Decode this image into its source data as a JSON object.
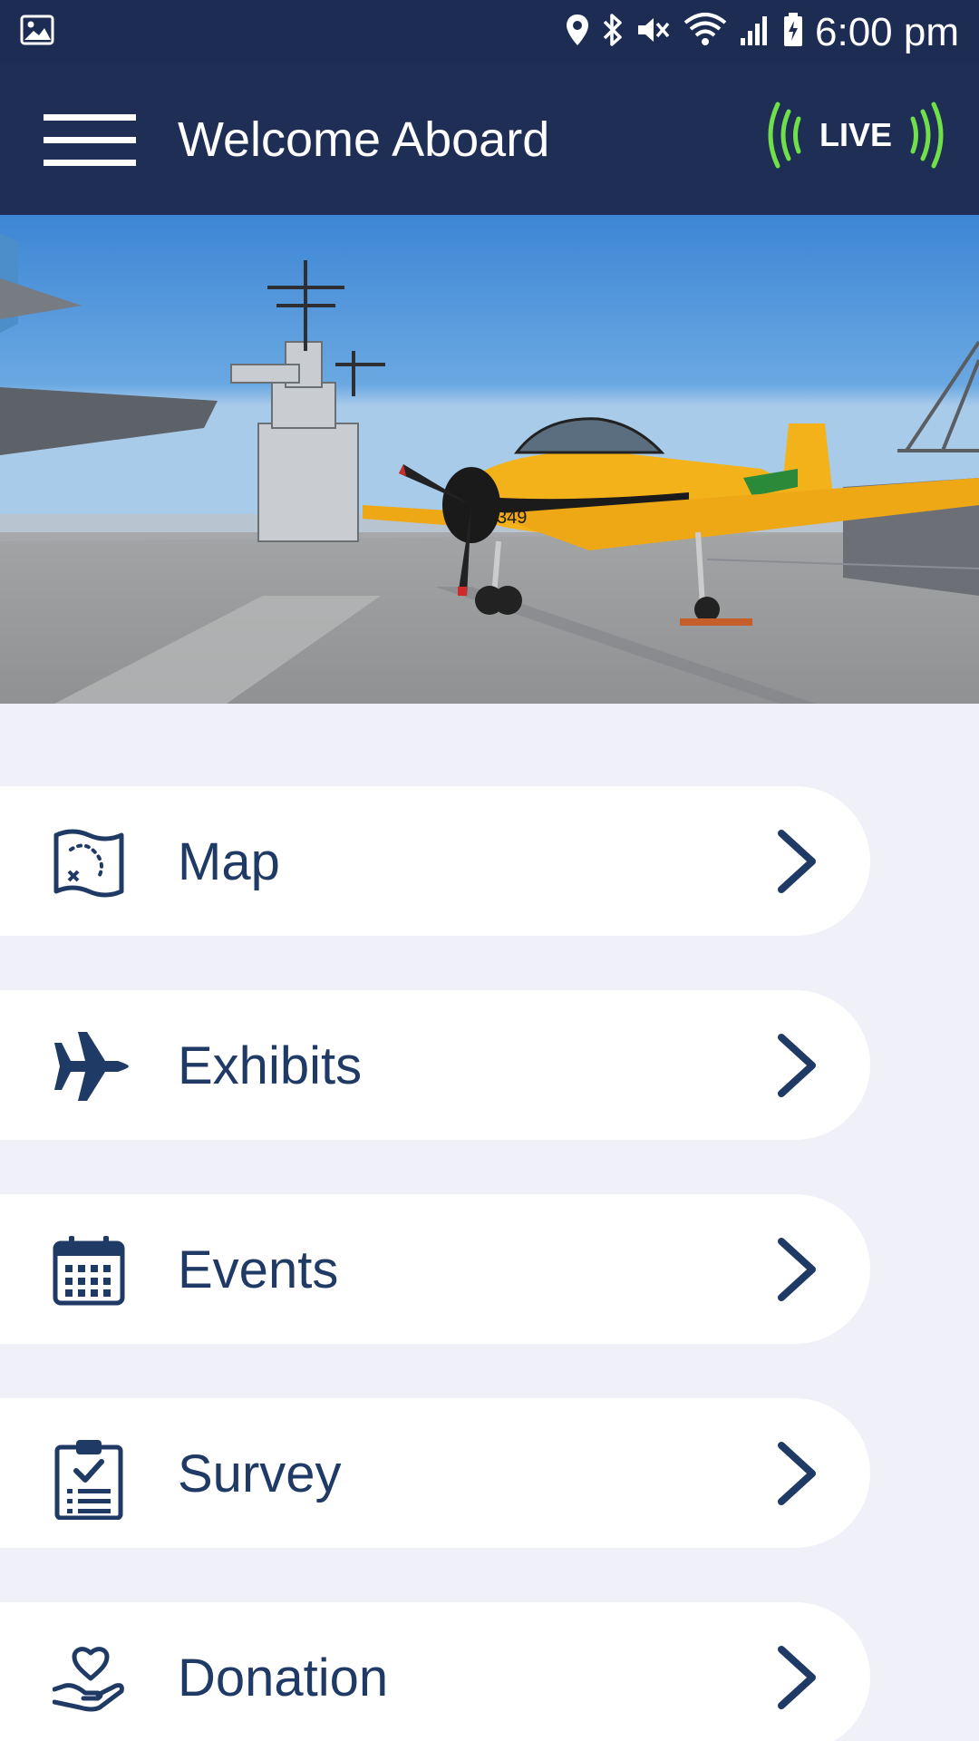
{
  "status_bar": {
    "time": "6:00 pm",
    "icons": [
      "image-icon",
      "location-icon",
      "bluetooth-icon",
      "vibrate-mute-icon",
      "wifi-icon",
      "signal-icon",
      "battery-icon"
    ]
  },
  "app_bar": {
    "title": "Welcome Aboard",
    "menu_icon": "hamburger-menu-icon",
    "live_label": "LIVE"
  },
  "hero": {
    "description_icon": "aircraft-carrier-photo",
    "plane_marking": "349"
  },
  "menu": {
    "items": [
      {
        "label": "Map",
        "icon": "map-icon"
      },
      {
        "label": "Exhibits",
        "icon": "airplane-icon"
      },
      {
        "label": "Events",
        "icon": "calendar-icon"
      },
      {
        "label": "Survey",
        "icon": "clipboard-icon"
      },
      {
        "label": "Donation",
        "icon": "heart-hand-icon"
      }
    ]
  },
  "colors": {
    "navy": "#1f2e55",
    "status_bar": "#1c2c52",
    "background": "#eff0f8",
    "item_text": "#1f3a65",
    "live_green": "#6fe04a",
    "plane_yellow": "#f3b21a"
  }
}
